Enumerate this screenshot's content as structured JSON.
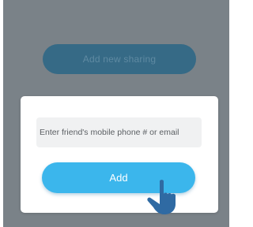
{
  "background": {
    "add_sharing_button_label": "Add new sharing"
  },
  "modal": {
    "input_placeholder": "Enter friend's mobile phone # or email",
    "input_value": "",
    "add_button_label": "Add"
  },
  "icons": {
    "cursor": "hand-pointer-icon"
  },
  "colors": {
    "overlay": "#7a8288",
    "accent": "#3bb6ec",
    "dimmed_button": "#366a86",
    "cursor": "#2f6aa3"
  }
}
